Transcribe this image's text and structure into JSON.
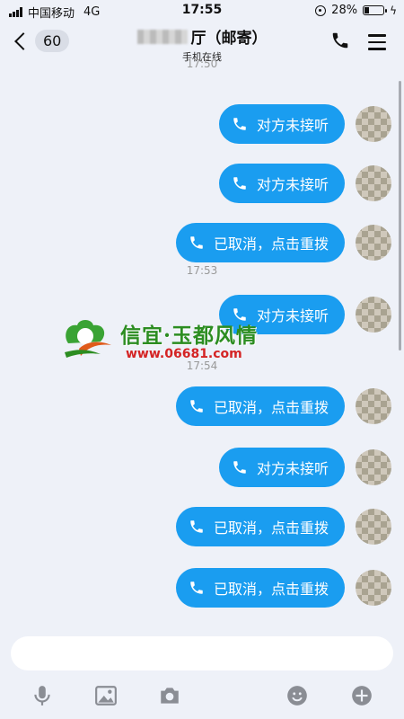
{
  "status_bar": {
    "carrier": "中国移动",
    "network": "4G",
    "time": "17:55",
    "battery_percent": "28%",
    "battery_level": 0.28
  },
  "header": {
    "back_count": "60",
    "title_suffix": "厅（邮寄）",
    "subtitle": "手机在线"
  },
  "messages": [
    {
      "type": "timestamp",
      "text": "17:50"
    },
    {
      "type": "call",
      "text": "对方未接听"
    },
    {
      "type": "call",
      "text": "对方未接听"
    },
    {
      "type": "call",
      "text": "已取消，点击重拨"
    },
    {
      "type": "timestamp",
      "text": "17:53"
    },
    {
      "type": "call",
      "text": "对方未接听"
    },
    {
      "type": "timestamp",
      "text": "17:54"
    },
    {
      "type": "call",
      "text": "已取消，点击重拨"
    },
    {
      "type": "call",
      "text": "对方未接听"
    },
    {
      "type": "call",
      "text": "已取消，点击重拨"
    },
    {
      "type": "call",
      "text": "已取消，点击重拨"
    }
  ],
  "watermark": {
    "name": "信宜·玉都风情",
    "url": "www.06681.com"
  },
  "toolbar_icons": [
    "microphone-icon",
    "image-icon",
    "camera-icon",
    "emoji-icon",
    "plus-icon"
  ],
  "colors": {
    "bubble": "#1a9df0",
    "background": "#eef1f8"
  }
}
